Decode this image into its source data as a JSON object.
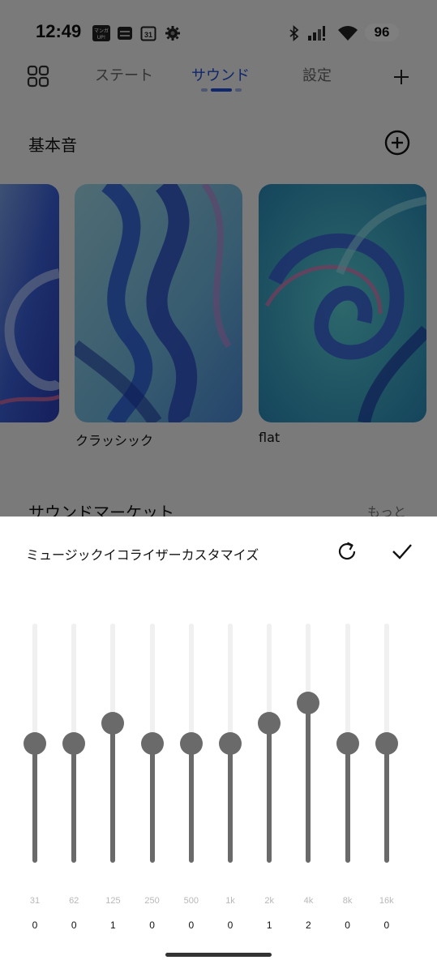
{
  "status": {
    "time": "12:49",
    "battery": "96",
    "app_badge_text": "マンガ UP!",
    "calendar_date": "31"
  },
  "nav": {
    "tabs": [
      {
        "label": "ステート",
        "active": false
      },
      {
        "label": "サウンド",
        "active": true
      },
      {
        "label": "設定",
        "active": false
      }
    ]
  },
  "basic_sounds": {
    "title": "基本音",
    "cards": [
      {
        "label": ""
      },
      {
        "label": "クラッシック"
      },
      {
        "label": "flat"
      }
    ]
  },
  "market": {
    "title": "サウンドマーケット",
    "more": "もっと"
  },
  "equalizer": {
    "title": "ミュージックイコライザーカスタマイズ",
    "range": [
      -6,
      6
    ],
    "bands": [
      {
        "freq": "31",
        "value": "0"
      },
      {
        "freq": "62",
        "value": "0"
      },
      {
        "freq": "125",
        "value": "1"
      },
      {
        "freq": "250",
        "value": "0"
      },
      {
        "freq": "500",
        "value": "0"
      },
      {
        "freq": "1k",
        "value": "0"
      },
      {
        "freq": "2k",
        "value": "1"
      },
      {
        "freq": "4k",
        "value": "2"
      },
      {
        "freq": "8k",
        "value": "0"
      },
      {
        "freq": "16k",
        "value": "0"
      }
    ]
  },
  "colors": {
    "accent": "#1e4fd8",
    "slider": "#6a6a6a",
    "track": "#f0f0f0"
  }
}
